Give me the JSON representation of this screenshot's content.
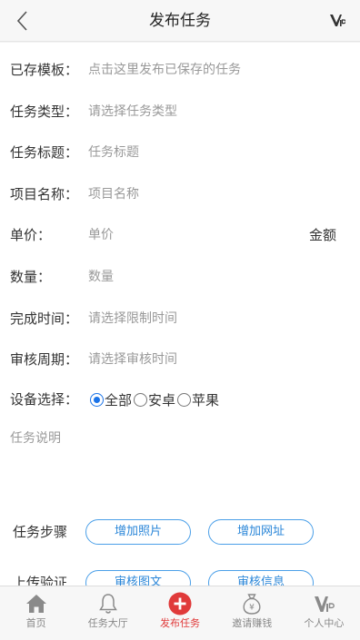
{
  "header": {
    "title": "发布任务",
    "back_icon": "chevron-left-icon",
    "right_icon": "vip-icon"
  },
  "form": {
    "saved_template": {
      "label": "已存模板：",
      "placeholder": "点击这里发布已保存的任务"
    },
    "task_type": {
      "label": "任务类型：",
      "placeholder": "请选择任务类型"
    },
    "task_title": {
      "label": "任务标题：",
      "placeholder": "任务标题"
    },
    "project_name": {
      "label": "项目名称：",
      "placeholder": "项目名称"
    },
    "unit_price": {
      "label": "单价：",
      "placeholder": "单价",
      "suffix": "金额"
    },
    "quantity": {
      "label": "数量：",
      "placeholder": "数量"
    },
    "finish_time": {
      "label": "完成时间：",
      "placeholder": "请选择限制时间"
    },
    "review_period": {
      "label": "审核周期：",
      "placeholder": "请选择审核时间"
    },
    "device": {
      "label": "设备选择：",
      "options": [
        {
          "label": "全部",
          "checked": true
        },
        {
          "label": "安卓",
          "checked": false
        },
        {
          "label": "苹果",
          "checked": false
        }
      ]
    },
    "description": {
      "placeholder": "任务说明"
    },
    "steps": {
      "label": "任务步骤",
      "add_photo": "增加照片",
      "add_url": "增加网址"
    },
    "upload_verify": {
      "label": "上传验证",
      "review_image_text": "审核图文",
      "review_info": "审核信息"
    }
  },
  "tabbar": {
    "items": [
      {
        "label": "首页",
        "icon": "home-icon",
        "active": false
      },
      {
        "label": "任务大厅",
        "icon": "bell-icon",
        "active": false
      },
      {
        "label": "发布任务",
        "icon": "plus-circle-icon",
        "active": true
      },
      {
        "label": "邀请赚钱",
        "icon": "money-bag-icon",
        "active": false
      },
      {
        "label": "个人中心",
        "icon": "vip-icon",
        "active": false
      }
    ]
  },
  "colors": {
    "accent": "#e03a3a",
    "link_blue": "#2a86d8",
    "radio_blue": "#1a73e8"
  }
}
